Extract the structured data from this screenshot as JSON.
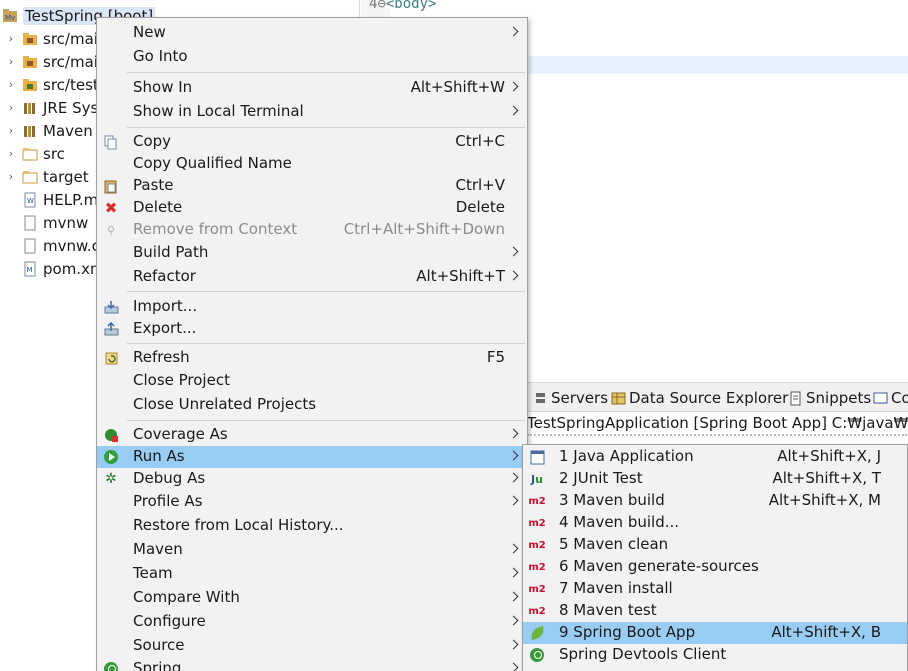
{
  "explorer": {
    "project_label": "TestSpring [boot]",
    "items": [
      {
        "label": "src/main",
        "icon": "package-folder-icon",
        "expandable": true
      },
      {
        "label": "src/main",
        "icon": "package-folder-icon",
        "expandable": true
      },
      {
        "label": "src/test/",
        "icon": "package-folder-icon",
        "expandable": true
      },
      {
        "label": "JRE Syst",
        "icon": "library-icon",
        "expandable": true
      },
      {
        "label": "Maven",
        "icon": "library-icon",
        "expandable": true
      },
      {
        "label": "src",
        "icon": "folder-icon",
        "expandable": true
      },
      {
        "label": "target",
        "icon": "folder-icon",
        "expandable": true
      },
      {
        "label": "HELP.m",
        "icon": "document-icon",
        "expandable": false
      },
      {
        "label": "mvnw",
        "icon": "file-icon",
        "expandable": false
      },
      {
        "label": "mvnw.c",
        "icon": "file-icon",
        "expandable": false
      },
      {
        "label": "pom.xm",
        "icon": "maven-file-icon",
        "expandable": false
      }
    ]
  },
  "editor": {
    "line_number": "4",
    "line_fold": "⊖",
    "line_code": "<body>"
  },
  "bottom_panel": {
    "tabs": [
      {
        "label": "Servers",
        "icon": "servers-icon"
      },
      {
        "label": "Data Source Explorer",
        "icon": "data-source-icon"
      },
      {
        "label": "Snippets",
        "icon": "snippets-icon"
      },
      {
        "label": "Co",
        "icon": "console-icon"
      }
    ],
    "console_header": "TestSpringApplication [Spring Boot App] C:₩java₩jdk-"
  },
  "context_menu": {
    "items": [
      {
        "label": "New",
        "accel": "",
        "submenu": true,
        "icon": ""
      },
      {
        "label": "Go Into",
        "accel": "",
        "submenu": false,
        "icon": ""
      },
      {
        "label": "Show In",
        "accel": "Alt+Shift+W",
        "submenu": true,
        "icon": ""
      },
      {
        "label": "Show in Local Terminal",
        "accel": "",
        "submenu": true,
        "icon": ""
      },
      {
        "label": "Copy",
        "accel": "Ctrl+C",
        "submenu": false,
        "icon": "copy-icon"
      },
      {
        "label": "Copy Qualified Name",
        "accel": "",
        "submenu": false,
        "icon": ""
      },
      {
        "label": "Paste",
        "accel": "Ctrl+V",
        "submenu": false,
        "icon": "paste-icon"
      },
      {
        "label": "Delete",
        "accel": "Delete",
        "submenu": false,
        "icon": "delete-icon"
      },
      {
        "label": "Remove from Context",
        "accel": "Ctrl+Alt+Shift+Down",
        "submenu": false,
        "icon": "remove-context-icon",
        "disabled": true
      },
      {
        "label": "Build Path",
        "accel": "",
        "submenu": true,
        "icon": ""
      },
      {
        "label": "Refactor",
        "accel": "Alt+Shift+T",
        "submenu": true,
        "icon": ""
      },
      {
        "label": "Import...",
        "accel": "",
        "submenu": false,
        "icon": "import-icon"
      },
      {
        "label": "Export...",
        "accel": "",
        "submenu": false,
        "icon": "export-icon"
      },
      {
        "label": "Refresh",
        "accel": "F5",
        "submenu": false,
        "icon": "refresh-icon"
      },
      {
        "label": "Close Project",
        "accel": "",
        "submenu": false,
        "icon": ""
      },
      {
        "label": "Close Unrelated Projects",
        "accel": "",
        "submenu": false,
        "icon": ""
      },
      {
        "label": "Coverage As",
        "accel": "",
        "submenu": true,
        "icon": "coverage-icon"
      },
      {
        "label": "Run As",
        "accel": "",
        "submenu": true,
        "icon": "run-icon",
        "selected": true
      },
      {
        "label": "Debug As",
        "accel": "",
        "submenu": true,
        "icon": "debug-icon"
      },
      {
        "label": "Profile As",
        "accel": "",
        "submenu": true,
        "icon": ""
      },
      {
        "label": "Restore from Local History...",
        "accel": "",
        "submenu": false,
        "icon": ""
      },
      {
        "label": "Maven",
        "accel": "",
        "submenu": true,
        "icon": ""
      },
      {
        "label": "Team",
        "accel": "",
        "submenu": true,
        "icon": ""
      },
      {
        "label": "Compare With",
        "accel": "",
        "submenu": true,
        "icon": ""
      },
      {
        "label": "Configure",
        "accel": "",
        "submenu": true,
        "icon": ""
      },
      {
        "label": "Source",
        "accel": "",
        "submenu": true,
        "icon": ""
      },
      {
        "label": "Spring",
        "accel": "",
        "submenu": true,
        "icon": "spring-icon"
      }
    ]
  },
  "run_as_submenu": {
    "items": [
      {
        "label": "1 Java Application",
        "accel": "Alt+Shift+X, J",
        "icon": "java-app-icon",
        "glyph": "J"
      },
      {
        "label": "2 JUnit Test",
        "accel": "Alt+Shift+X, T",
        "icon": "junit-icon",
        "glyph": "Ju"
      },
      {
        "label": "3 Maven build",
        "accel": "Alt+Shift+X, M",
        "icon": "maven-m2-icon",
        "glyph": "m2"
      },
      {
        "label": "4 Maven build...",
        "accel": "",
        "icon": "maven-m2-icon",
        "glyph": "m2"
      },
      {
        "label": "5 Maven clean",
        "accel": "",
        "icon": "maven-m2-icon",
        "glyph": "m2"
      },
      {
        "label": "6 Maven generate-sources",
        "accel": "",
        "icon": "maven-m2-icon",
        "glyph": "m2"
      },
      {
        "label": "7 Maven install",
        "accel": "",
        "icon": "maven-m2-icon",
        "glyph": "m2"
      },
      {
        "label": "8 Maven test",
        "accel": "",
        "icon": "maven-m2-icon",
        "glyph": "m2"
      },
      {
        "label": "9 Spring Boot App",
        "accel": "Alt+Shift+X, B",
        "icon": "spring-boot-icon",
        "glyph": "",
        "selected": true
      },
      {
        "label": "Spring Devtools Client",
        "accel": "",
        "icon": "spring-devtools-icon",
        "glyph": ""
      }
    ]
  },
  "colors": {
    "selection": "#99ccf3",
    "menu_bg": "#f2f2f2",
    "maven_red": "#c8102e",
    "spring_green": "#6db33f"
  }
}
